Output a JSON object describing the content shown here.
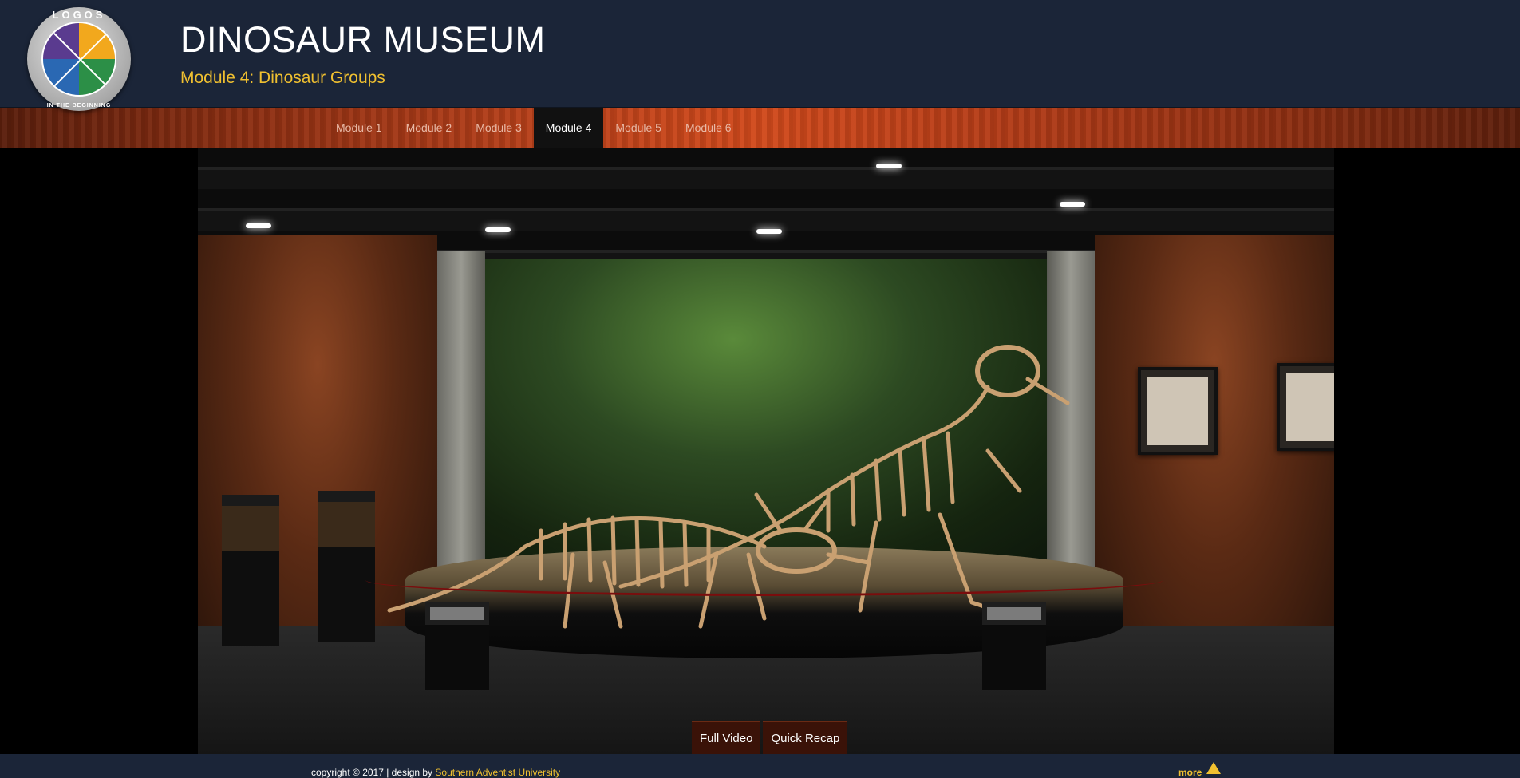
{
  "header": {
    "logo_top_text": "LOGOS",
    "logo_bottom_text": "IN THE BEGINNING",
    "title": "DINOSAUR MUSEUM",
    "subtitle": "Module 4: Dinosaur Groups"
  },
  "nav": {
    "items": [
      {
        "label": "Module 1"
      },
      {
        "label": "Module 2"
      },
      {
        "label": "Module 3"
      },
      {
        "label": "Module 4",
        "active": true
      },
      {
        "label": "Module 5"
      },
      {
        "label": "Module 6"
      }
    ]
  },
  "stage": {
    "scene": "museum-hall-dinosaur-skeletons",
    "buttons": {
      "full_video": "Full Video",
      "quick_recap": "Quick Recap"
    }
  },
  "footer": {
    "copyright": "copyright © 2017 | design by ",
    "designer": "Southern Adventist University",
    "more": "more"
  },
  "colors": {
    "header_bg": "#1b2538",
    "accent": "#f0c030",
    "nav_wood": "#b8401a"
  }
}
